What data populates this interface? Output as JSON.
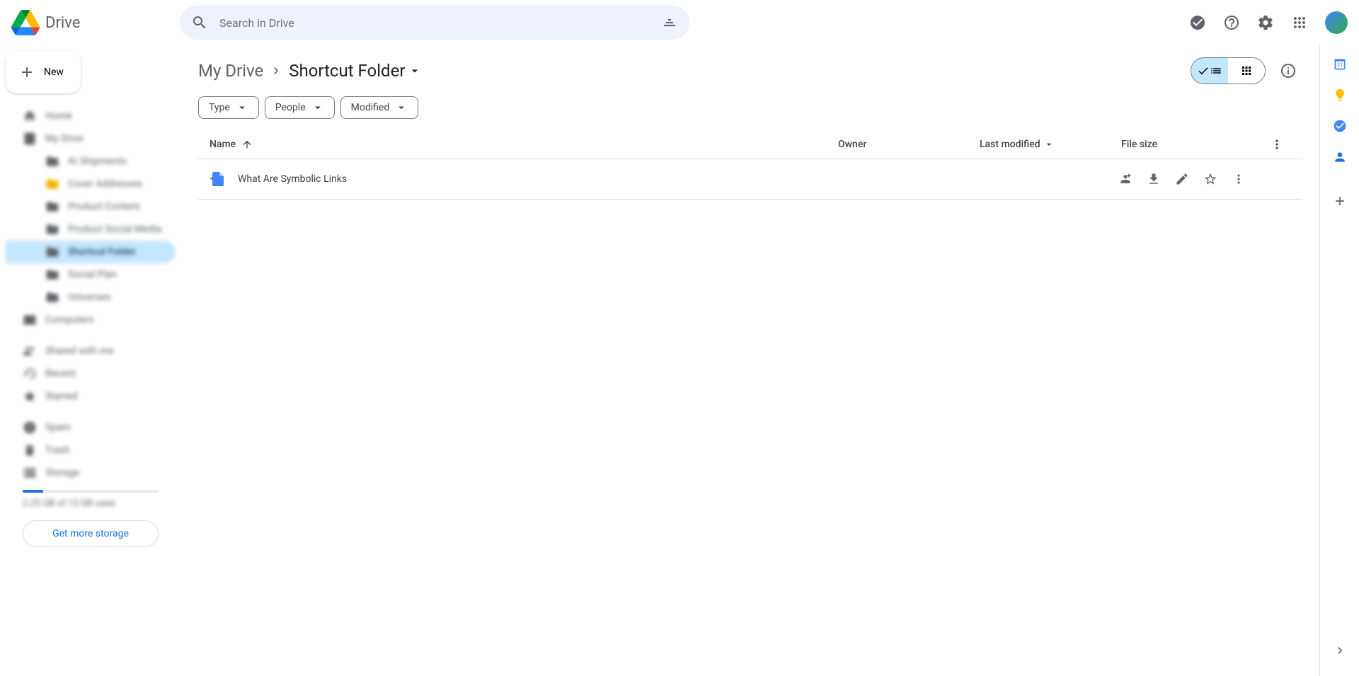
{
  "app_title": "Drive",
  "search": {
    "placeholder": "Search in Drive"
  },
  "new_button": "New",
  "sidebar": {
    "items": [
      {
        "label": "Home",
        "icon": "home"
      },
      {
        "label": "My Drive",
        "icon": "drive"
      },
      {
        "label": "AI Shipments",
        "icon": "folder",
        "child": true
      },
      {
        "label": "Cover Addresses",
        "icon": "folder",
        "child": true,
        "starred": true
      },
      {
        "label": "Product Content",
        "icon": "folder",
        "child": true
      },
      {
        "label": "Product Social Media",
        "icon": "folder",
        "child": true
      },
      {
        "label": "Shortcut Folder",
        "icon": "folder",
        "child": true,
        "active": true
      },
      {
        "label": "Social Plan",
        "icon": "folder",
        "child": true
      },
      {
        "label": "Universes",
        "icon": "folder",
        "child": true
      },
      {
        "label": "Computers",
        "icon": "computers"
      },
      {
        "label": "Shared with me",
        "icon": "shared"
      },
      {
        "label": "Recent",
        "icon": "recent"
      },
      {
        "label": "Starred",
        "icon": "star"
      },
      {
        "label": "Spam",
        "icon": "spam"
      },
      {
        "label": "Trash",
        "icon": "trash"
      },
      {
        "label": "Storage",
        "icon": "storage"
      }
    ],
    "storage_text": "2.25 GB of 15 GB used",
    "storage_button": "Get more storage"
  },
  "breadcrumb": {
    "parent": "My Drive",
    "current": "Shortcut Folder"
  },
  "filters": [
    {
      "label": "Type"
    },
    {
      "label": "People"
    },
    {
      "label": "Modified"
    }
  ],
  "columns": {
    "name": "Name",
    "owner": "Owner",
    "modified": "Last modified",
    "size": "File size"
  },
  "rows": [
    {
      "name": "What Are Symbolic Links",
      "type": "doc"
    }
  ]
}
